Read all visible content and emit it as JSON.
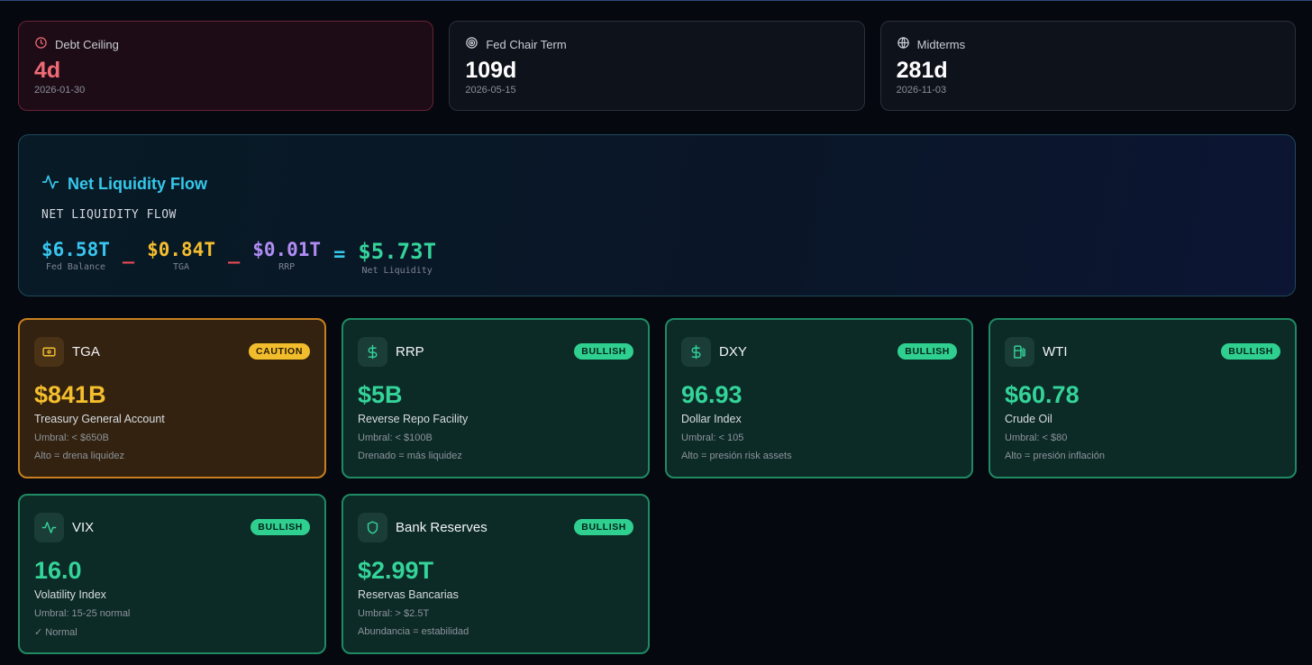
{
  "countdowns": [
    {
      "label": "Debt Ceiling",
      "value": "4d",
      "date": "2026-01-30",
      "icon": "clock-icon"
    },
    {
      "label": "Fed Chair Term",
      "value": "109d",
      "date": "2026-05-15",
      "icon": "target-icon"
    },
    {
      "label": "Midterms",
      "value": "281d",
      "date": "2026-11-03",
      "icon": "globe-icon"
    }
  ],
  "liquidity": {
    "title": "Net Liquidity Flow",
    "subtitle": "NET LIQUIDITY FLOW",
    "terms": [
      {
        "value": "$6.58T",
        "label": "Fed Balance",
        "color": "#38c6f0"
      },
      {
        "value": "$0.84T",
        "label": "TGA",
        "color": "#f5be2e"
      },
      {
        "value": "$0.01T",
        "label": "RRP",
        "color": "#b18cf5"
      },
      {
        "value": "$5.73T",
        "label": "Net Liquidity",
        "color": "#34d399"
      }
    ],
    "minus": "_",
    "equals": "="
  },
  "indicators": [
    {
      "name": "TGA",
      "badge": "CAUTION",
      "value": "$841B",
      "desc": "Treasury General Account",
      "threshold": "Umbral: < $650B",
      "note": "Alto = drena liquidez",
      "icon": "wallet-icon"
    },
    {
      "name": "RRP",
      "badge": "BULLISH",
      "value": "$5B",
      "desc": "Reverse Repo Facility",
      "threshold": "Umbral: < $100B",
      "note": "Drenado = más liquidez",
      "icon": "dollar-icon"
    },
    {
      "name": "DXY",
      "badge": "BULLISH",
      "value": "96.93",
      "desc": "Dollar Index",
      "threshold": "Umbral: < 105",
      "note": "Alto = presión risk assets",
      "icon": "dollar-icon"
    },
    {
      "name": "WTI",
      "badge": "BULLISH",
      "value": "$60.78",
      "desc": "Crude Oil",
      "threshold": "Umbral: < $80",
      "note": "Alto = presión inflación",
      "icon": "fuel-icon"
    },
    {
      "name": "VIX",
      "badge": "BULLISH",
      "value": "16.0",
      "desc": "Volatility Index",
      "threshold": "Umbral: 15-25 normal",
      "note": "✓ Normal",
      "icon": "activity-icon"
    },
    {
      "name": "Bank Reserves",
      "badge": "BULLISH",
      "value": "$2.99T",
      "desc": "Reservas Bancarias",
      "threshold": "Umbral: > $2.5T",
      "note": "Abundancia = estabilidad",
      "icon": "shield-icon"
    }
  ]
}
